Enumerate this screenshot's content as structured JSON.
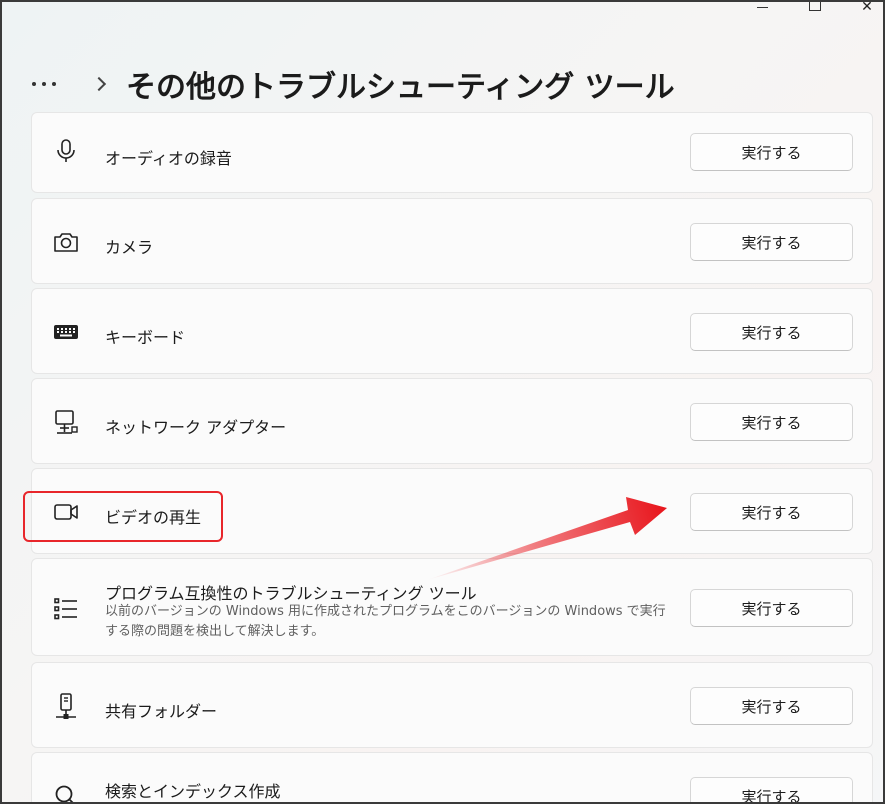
{
  "window": {
    "controls": {
      "minimize": "—",
      "maximize": "☐",
      "close": "✕"
    }
  },
  "header": {
    "more_icon": "more-dots-icon",
    "separator_icon": "chevron-right-icon",
    "title": "その他のトラブルシューティング ツール"
  },
  "items": [
    {
      "icon": "microphone-icon",
      "label": "オーディオの録音",
      "button": "実行する"
    },
    {
      "icon": "camera-icon",
      "label": "カメラ",
      "button": "実行する"
    },
    {
      "icon": "keyboard-icon",
      "label": "キーボード",
      "button": "実行する"
    },
    {
      "icon": "network-adapter-icon",
      "label": "ネットワーク アダプター",
      "button": "実行する"
    },
    {
      "icon": "video-camera-icon",
      "label": "ビデオの再生",
      "button": "実行する"
    },
    {
      "icon": "list-icon",
      "label": "プログラム互換性のトラブルシューティング ツール",
      "description": "以前のバージョンの Windows 用に作成されたプログラムをこのバージョンの Windows で実行する際の問題を検出して解決します。",
      "button": "実行する"
    },
    {
      "icon": "shared-folder-icon",
      "label": "共有フォルダー",
      "button": "実行する"
    },
    {
      "icon": "search-icon",
      "label": "検索とインデックス作成",
      "button": "実行する"
    }
  ],
  "annotation": {
    "highlight_color": "#e8262b",
    "arrow_color": "#e8141b"
  }
}
